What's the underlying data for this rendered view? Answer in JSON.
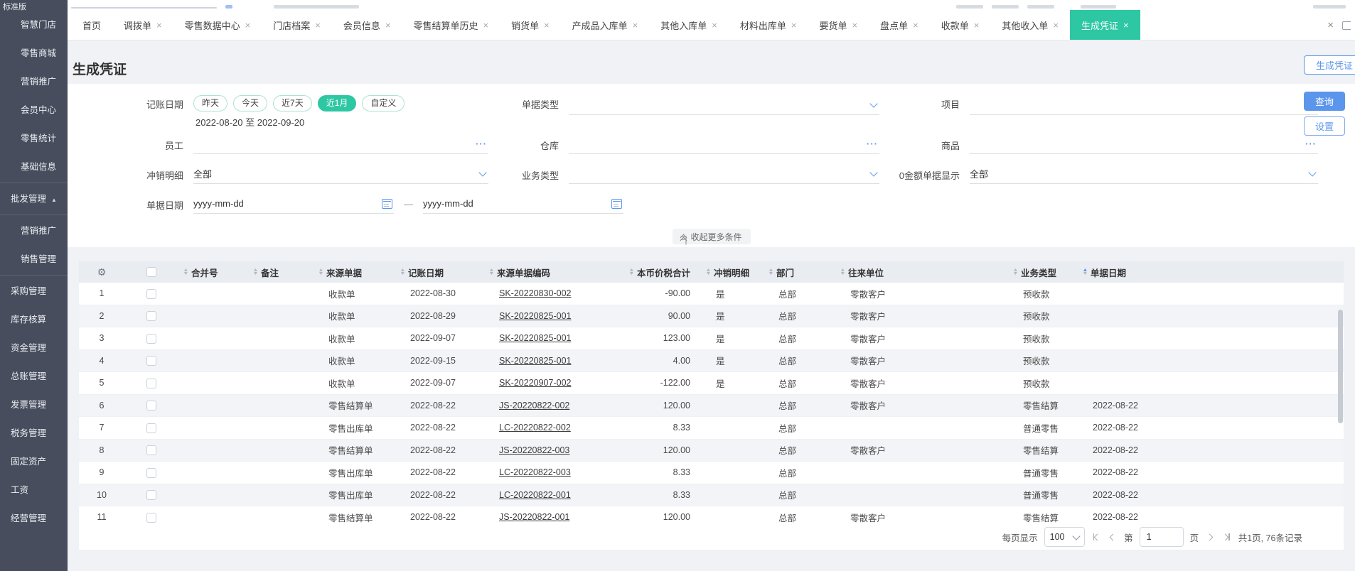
{
  "topbar": {
    "brand": "标准版"
  },
  "sidebar": {
    "items": [
      {
        "id": "smart-store",
        "label": "智慧门店",
        "indent": true
      },
      {
        "id": "retail-mall",
        "label": "零售商城",
        "indent": true
      },
      {
        "id": "marketing-retail",
        "label": "营销推广",
        "indent": true
      },
      {
        "id": "member-center",
        "label": "会员中心",
        "indent": true
      },
      {
        "id": "retail-stats",
        "label": "零售统计",
        "indent": true
      },
      {
        "id": "base-info",
        "label": "基础信息",
        "indent": true
      },
      {
        "divider": true
      },
      {
        "id": "wholesale-mgmt",
        "label": "批发管理",
        "arrow": "▲"
      },
      {
        "divider": true
      },
      {
        "id": "marketing-wholesale",
        "label": "营销推广",
        "indent": true
      },
      {
        "id": "sales-mgmt",
        "label": "销售管理",
        "indent": true
      },
      {
        "divider": true
      },
      {
        "id": "purchase-mgmt",
        "label": "采购管理"
      },
      {
        "id": "inventory-accounting",
        "label": "库存核算"
      },
      {
        "id": "funds-mgmt",
        "label": "资金管理"
      },
      {
        "id": "general-ledger",
        "label": "总账管理"
      },
      {
        "id": "invoice-mgmt",
        "label": "发票管理"
      },
      {
        "id": "tax-mgmt",
        "label": "税务管理"
      },
      {
        "id": "fixed-assets",
        "label": "固定资产"
      },
      {
        "id": "payroll",
        "label": "工资"
      },
      {
        "id": "business-mgmt",
        "label": "经营管理"
      }
    ]
  },
  "tabs": {
    "items": [
      {
        "label": "首页",
        "closable": false,
        "active": false
      },
      {
        "label": "调拨单",
        "closable": true,
        "active": false
      },
      {
        "label": "零售数据中心",
        "closable": true,
        "active": false
      },
      {
        "label": "门店档案",
        "closable": true,
        "active": false
      },
      {
        "label": "会员信息",
        "closable": true,
        "active": false
      },
      {
        "label": "零售结算单历史",
        "closable": true,
        "active": false
      },
      {
        "label": "销货单",
        "closable": true,
        "active": false
      },
      {
        "label": "产成品入库单",
        "closable": true,
        "active": false
      },
      {
        "label": "其他入库单",
        "closable": true,
        "active": false
      },
      {
        "label": "材料出库单",
        "closable": true,
        "active": false
      },
      {
        "label": "要货单",
        "closable": true,
        "active": false
      },
      {
        "label": "盘点单",
        "closable": true,
        "active": false
      },
      {
        "label": "收款单",
        "closable": true,
        "active": false
      },
      {
        "label": "其他收入单",
        "closable": true,
        "active": false
      },
      {
        "label": "生成凭证",
        "closable": true,
        "active": true
      }
    ],
    "close_all": "×"
  },
  "page": {
    "title": "生成凭证",
    "generate_button": "生成凭证"
  },
  "filters": {
    "booking_date": {
      "label": "记账日期",
      "pills": [
        "昨天",
        "今天",
        "近7天",
        "近1月",
        "自定义"
      ],
      "active_pill": "近1月",
      "range_text": "2022-08-20 至 2022-09-20"
    },
    "doc_type": {
      "label": "单据类型",
      "value": ""
    },
    "project": {
      "label": "项目",
      "value": ""
    },
    "employee": {
      "label": "员工",
      "value": ""
    },
    "warehouse": {
      "label": "仓库",
      "value": ""
    },
    "goods": {
      "label": "商品",
      "value": ""
    },
    "writeoff_detail": {
      "label": "冲销明细",
      "value": "全部"
    },
    "biz_type": {
      "label": "业务类型",
      "value": ""
    },
    "zero_amount": {
      "label": "0金额单据显示",
      "value": "全部"
    },
    "doc_date": {
      "label": "单据日期",
      "start_placeholder": "yyyy-mm-dd",
      "end_placeholder": "yyyy-mm-dd",
      "separator": "—"
    },
    "query_button": "查询",
    "settings_button": "设置",
    "collapse_text": "收起更多条件"
  },
  "table": {
    "columns": [
      "合并号",
      "备注",
      "来源单据",
      "记账日期",
      "来源单据编码",
      "本币价税合计",
      "冲销明细",
      "部门",
      "往来单位",
      "业务类型",
      "单据日期"
    ],
    "sorted_column": "单据日期",
    "sort_direction": "asc",
    "rows": [
      {
        "num": "1",
        "merge_no": "",
        "note": "",
        "source_doc": "收款单",
        "booking_date": "2022-08-30",
        "source_code": "SK-20220830-002",
        "amount": "-90.00",
        "writeoff": "是",
        "dept": "总部",
        "partner": "零散客户",
        "biz_type": "预收款",
        "doc_date": ""
      },
      {
        "num": "2",
        "merge_no": "",
        "note": "",
        "source_doc": "收款单",
        "booking_date": "2022-08-29",
        "source_code": "SK-20220825-001",
        "amount": "90.00",
        "writeoff": "是",
        "dept": "总部",
        "partner": "零散客户",
        "biz_type": "预收款",
        "doc_date": ""
      },
      {
        "num": "3",
        "merge_no": "",
        "note": "",
        "source_doc": "收款单",
        "booking_date": "2022-09-07",
        "source_code": "SK-20220825-001",
        "amount": "123.00",
        "writeoff": "是",
        "dept": "总部",
        "partner": "零散客户",
        "biz_type": "预收款",
        "doc_date": ""
      },
      {
        "num": "4",
        "merge_no": "",
        "note": "",
        "source_doc": "收款单",
        "booking_date": "2022-09-15",
        "source_code": "SK-20220825-001",
        "amount": "4.00",
        "writeoff": "是",
        "dept": "总部",
        "partner": "零散客户",
        "biz_type": "预收款",
        "doc_date": ""
      },
      {
        "num": "5",
        "merge_no": "",
        "note": "",
        "source_doc": "收款单",
        "booking_date": "2022-09-07",
        "source_code": "SK-20220907-002",
        "amount": "-122.00",
        "writeoff": "是",
        "dept": "总部",
        "partner": "零散客户",
        "biz_type": "预收款",
        "doc_date": ""
      },
      {
        "num": "6",
        "merge_no": "",
        "note": "",
        "source_doc": "零售结算单",
        "booking_date": "2022-08-22",
        "source_code": "JS-20220822-002",
        "amount": "120.00",
        "writeoff": "",
        "dept": "总部",
        "partner": "零散客户",
        "biz_type": "零售结算",
        "doc_date": "2022-08-22"
      },
      {
        "num": "7",
        "merge_no": "",
        "note": "",
        "source_doc": "零售出库单",
        "booking_date": "2022-08-22",
        "source_code": "LC-20220822-002",
        "amount": "8.33",
        "writeoff": "",
        "dept": "总部",
        "partner": "",
        "biz_type": "普通零售",
        "doc_date": "2022-08-22"
      },
      {
        "num": "8",
        "merge_no": "",
        "note": "",
        "source_doc": "零售结算单",
        "booking_date": "2022-08-22",
        "source_code": "JS-20220822-003",
        "amount": "120.00",
        "writeoff": "",
        "dept": "总部",
        "partner": "零散客户",
        "biz_type": "零售结算",
        "doc_date": "2022-08-22"
      },
      {
        "num": "9",
        "merge_no": "",
        "note": "",
        "source_doc": "零售出库单",
        "booking_date": "2022-08-22",
        "source_code": "LC-20220822-003",
        "amount": "8.33",
        "writeoff": "",
        "dept": "总部",
        "partner": "",
        "biz_type": "普通零售",
        "doc_date": "2022-08-22"
      },
      {
        "num": "10",
        "merge_no": "",
        "note": "",
        "source_doc": "零售出库单",
        "booking_date": "2022-08-22",
        "source_code": "LC-20220822-001",
        "amount": "8.33",
        "writeoff": "",
        "dept": "总部",
        "partner": "",
        "biz_type": "普通零售",
        "doc_date": "2022-08-22"
      },
      {
        "num": "11",
        "merge_no": "",
        "note": "",
        "source_doc": "零售结算单",
        "booking_date": "2022-08-22",
        "source_code": "JS-20220822-001",
        "amount": "120.00",
        "writeoff": "",
        "dept": "总部",
        "partner": "零散客户",
        "biz_type": "零售结算",
        "doc_date": "2022-08-22"
      }
    ]
  },
  "pagination": {
    "per_page_label": "每页显示",
    "per_page": "100",
    "page_prefix": "第",
    "page": "1",
    "page_suffix": "页",
    "summary": "共1页, 76条记录"
  },
  "colors": {
    "accent_blue": "#5b96ec",
    "accent_green": "#2ec7a3",
    "sidebar_bg": "#474d5c",
    "table_header_bg": "#e9ecf1"
  }
}
